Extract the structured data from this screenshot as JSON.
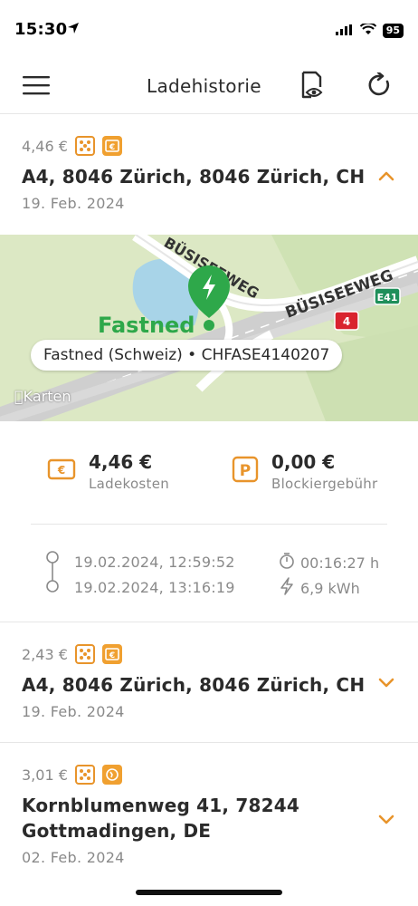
{
  "status": {
    "time": "15:30",
    "battery": "95"
  },
  "nav": {
    "title": "Ladehistorie"
  },
  "map": {
    "title": "Fastned (Schweiz) • CHFASE4140207",
    "attribution": "Karten",
    "roads": [
      "BÜSISEEWEG",
      "BÜSISEEWEG",
      "E41",
      "4"
    ],
    "poi": "Fastned"
  },
  "sessions": [
    {
      "price": "4,46 €",
      "address": "A4, 8046 Zürich, 8046 Zürich, CH",
      "date": "19. Feb. 2024",
      "expanded": true,
      "icon": "card-icon"
    },
    {
      "price": "2,43 €",
      "address": "A4, 8046 Zürich, 8046 Zürich, CH",
      "date": "19. Feb. 2024",
      "expanded": false,
      "icon": "card-icon"
    },
    {
      "price": "3,01 €",
      "address_line1": "Kornblumenweg 41, 78244",
      "address_line2": "Gottmadingen, DE",
      "date": "02. Feb. 2024",
      "expanded": false,
      "icon": "app-icon"
    }
  ],
  "details": {
    "charge_cost": "4,46 €",
    "charge_cost_label": "Ladekosten",
    "block_fee": "0,00 €",
    "block_fee_label": "Blockiergebühr",
    "start": "19.02.2024, 12:59:52",
    "end": "19.02.2024, 13:16:19",
    "duration": "00:16:27 h",
    "energy": "6,9 kWh"
  },
  "colors": {
    "accent": "#E8942B",
    "fastned_green": "#2EA84A",
    "text": "#2B2B2B",
    "muted": "#8A8A8A"
  }
}
